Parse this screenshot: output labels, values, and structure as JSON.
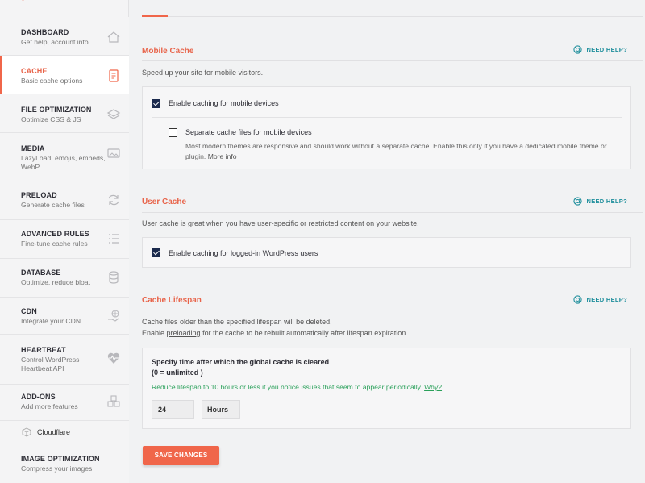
{
  "sidebar": {
    "items": [
      {
        "title": "DASHBOARD",
        "sub": "Get help, account info",
        "icon": "home-icon"
      },
      {
        "title": "CACHE",
        "sub": "Basic cache options",
        "icon": "document-icon"
      },
      {
        "title": "FILE OPTIMIZATION",
        "sub": "Optimize CSS & JS",
        "icon": "layers-icon"
      },
      {
        "title": "MEDIA",
        "sub": "LazyLoad, emojis, embeds, WebP",
        "icon": "image-icon"
      },
      {
        "title": "PRELOAD",
        "sub": "Generate cache files",
        "icon": "refresh-icon"
      },
      {
        "title": "ADVANCED RULES",
        "sub": "Fine-tune cache rules",
        "icon": "list-icon"
      },
      {
        "title": "DATABASE",
        "sub": "Optimize, reduce bloat",
        "icon": "database-icon"
      },
      {
        "title": "CDN",
        "sub": "Integrate your CDN",
        "icon": "globe-hand-icon"
      },
      {
        "title": "HEARTBEAT",
        "sub": "Control WordPress Heartbeat API",
        "icon": "heartbeat-icon"
      },
      {
        "title": "ADD-ONS",
        "sub": "Add more features",
        "icon": "cubes-icon"
      },
      {
        "title": "Cloudflare",
        "icon": "cube-icon"
      },
      {
        "title": "IMAGE OPTIMIZATION",
        "sub": "Compress your images"
      }
    ]
  },
  "help_label": "NEED HELP?",
  "mobile_cache": {
    "title": "Mobile Cache",
    "description": "Speed up your site for mobile visitors.",
    "enable_label": "Enable caching for mobile devices",
    "separate_label": "Separate cache files for mobile devices",
    "separate_desc_1": "Most modern themes are responsive and should work without a separate cache. Enable this only if you have a dedicated mobile theme or",
    "separate_desc_2": "plugin.",
    "more_info": "More info"
  },
  "user_cache": {
    "title": "User Cache",
    "desc_link": "User cache",
    "desc_rest": " is great when you have user-specific or restricted content on your website.",
    "enable_label": "Enable caching for logged-in WordPress users"
  },
  "cache_lifespan": {
    "title": "Cache Lifespan",
    "desc_line1": "Cache files older than the specified lifespan will be deleted.",
    "desc_line2_pre": "Enable ",
    "desc_line2_link": "preloading",
    "desc_line2_post": " for the cache to be rebuilt automatically after lifespan expiration.",
    "field_label": "Specify time after which the global cache is cleared",
    "field_hint": "(0 = unlimited )",
    "note": "Reduce lifespan to 10 hours or less if you notice issues that seem to appear periodically.",
    "note_link": "Why?",
    "value": "24",
    "unit": "Hours"
  },
  "save_button": "SAVE CHANGES",
  "colors": {
    "accent": "#f0664a",
    "help": "#1f8f9c",
    "note": "#2aa05a",
    "checkbox": "#1b2a4d"
  }
}
